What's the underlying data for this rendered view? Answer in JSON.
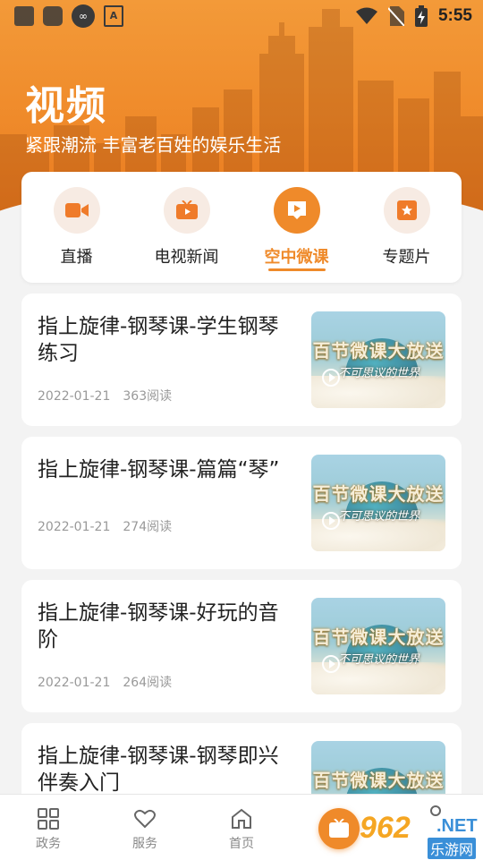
{
  "status_bar": {
    "time": "5:55"
  },
  "header": {
    "title": "视频",
    "subtitle": "紧跟潮流 丰富老百姓的娱乐生活"
  },
  "categories": [
    {
      "label": "直播",
      "icon": "video-camera-icon",
      "active": false
    },
    {
      "label": "电视新闻",
      "icon": "tv-icon",
      "active": false
    },
    {
      "label": "空中微课",
      "icon": "play-card-icon",
      "active": true
    },
    {
      "label": "专题片",
      "icon": "star-box-icon",
      "active": false
    }
  ],
  "thumbnail": {
    "headline": "百节微课大放送",
    "caption": "不可思议的世界"
  },
  "articles": [
    {
      "title": "指上旋律-钢琴课-学生钢琴练习",
      "date": "2022-01-21",
      "reads": "363阅读"
    },
    {
      "title": "指上旋律-钢琴课-篇篇“琴”",
      "date": "2022-01-21",
      "reads": "274阅读"
    },
    {
      "title": "指上旋律-钢琴课-好玩的音阶",
      "date": "2022-01-21",
      "reads": "264阅读"
    },
    {
      "title": "指上旋律-钢琴课-钢琴即兴伴奏入门",
      "date": "",
      "reads": ""
    }
  ],
  "bottom_nav": [
    {
      "label": "政务",
      "icon": "grid-icon"
    },
    {
      "label": "服务",
      "icon": "heart-icon"
    },
    {
      "label": "首页",
      "icon": "home-icon"
    },
    {
      "label": "",
      "icon": "tv-center-icon"
    },
    {
      "label": "",
      "icon": "person-icon"
    }
  ],
  "watermark": {
    "brand": "962",
    "suffix": ".NET",
    "name": "乐游网"
  },
  "colors": {
    "accent": "#ef8a2a",
    "background": "#f3f3f3"
  }
}
